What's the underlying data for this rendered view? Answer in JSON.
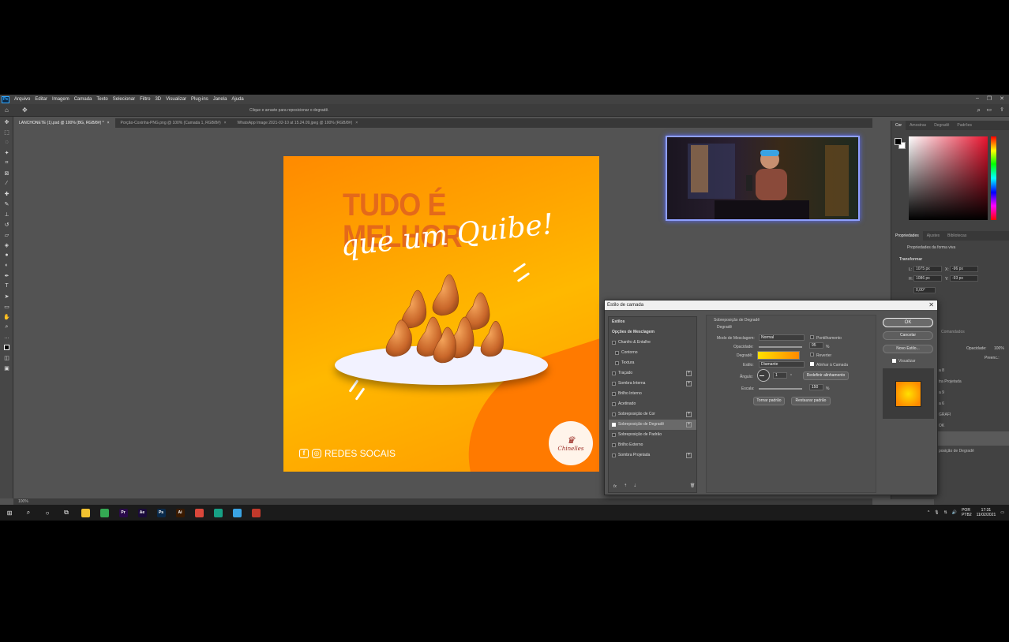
{
  "menu": [
    "Arquivo",
    "Editar",
    "Imagem",
    "Camada",
    "Texto",
    "Selecionar",
    "Filtro",
    "3D",
    "Visualizar",
    "Plug-ins",
    "Janela",
    "Ajuda"
  ],
  "options_hint": "Clique e arraste para reposicionar o degradê.",
  "tabs": [
    {
      "label": "LANCHONETE (1).psd @ 100% (BG, RGB/8#) *",
      "active": true
    },
    {
      "label": "Porção-Coxinha-PNG.png @ 100% (Camada 1, RGB/8#)",
      "active": false
    },
    {
      "label": "WhatsApp Image 2021-02-10 at 15.24.09.jpeg @ 100% (RGB/8#)",
      "active": false
    }
  ],
  "artwork": {
    "headline": "TUDO É MELHOR",
    "script": "que um Quibe!",
    "social": "REDES SOCAIS",
    "logo_text": "Chinelles",
    "colors": {
      "bg_start": "#ff8a00",
      "bg_mid": "#ffb800",
      "headline": "#e4691a"
    }
  },
  "right_panel": {
    "color_tabs": [
      "Cor",
      "Amostras",
      "Degradê",
      "Padrões"
    ],
    "prop_tabs": [
      "Propriedades",
      "Ajustes",
      "Bibliotecas"
    ],
    "shape_props": "Propriedades da forma viva",
    "transform": "Transformar",
    "W": "1075 px",
    "X": "-96 px",
    "H": "1086 px",
    "Y": "-93 px",
    "angle": "0,00°",
    "layers_tab": "Comandados",
    "opacity_label": "Opacidade:",
    "opacity_value": "100%",
    "fill_label": "Preenc.:",
    "layers": [
      "a 8",
      "tra Projetada",
      "a 9",
      "a 6",
      "GRAFI",
      "OK",
      "",
      "posição de Degradê"
    ]
  },
  "status": "100%",
  "dialog": {
    "title": "Estilo de camada",
    "styles": [
      {
        "label": "Estilos",
        "check": false,
        "plus": false,
        "header": true
      },
      {
        "label": "Opções de Mesclagem",
        "check": false,
        "plus": false,
        "header": true
      },
      {
        "label": "Chanfro & Entalhe",
        "check": true,
        "on": false,
        "plus": false
      },
      {
        "label": "Contorno",
        "check": true,
        "on": false,
        "plus": false,
        "indent": true
      },
      {
        "label": "Textura",
        "check": true,
        "on": false,
        "plus": false,
        "indent": true
      },
      {
        "label": "Traçado",
        "check": true,
        "on": false,
        "plus": true
      },
      {
        "label": "Sombra Interna",
        "check": true,
        "on": false,
        "plus": true
      },
      {
        "label": "Brilho Interno",
        "check": true,
        "on": false,
        "plus": false
      },
      {
        "label": "Acetinado",
        "check": true,
        "on": false,
        "plus": false
      },
      {
        "label": "Sobreposição de Cor",
        "check": true,
        "on": false,
        "plus": true
      },
      {
        "label": "Sobreposição de Degradê",
        "check": true,
        "on": true,
        "plus": true,
        "selected": true
      },
      {
        "label": "Sobreposição de Padrão",
        "check": true,
        "on": false,
        "plus": false
      },
      {
        "label": "Brilho Externo",
        "check": true,
        "on": false,
        "plus": false
      },
      {
        "label": "Sombra Projetada",
        "check": true,
        "on": false,
        "plus": true
      }
    ],
    "section_title": "Sobreposição de Degradê",
    "sub_title": "Degradê",
    "blend_label": "Modo de Mesclagem:",
    "blend_value": "Normal",
    "dither": "Pontilhamento",
    "opacity_label": "Opacidade:",
    "opacity_value": "95",
    "pct": "%",
    "gradient_label": "Degradê:",
    "reverse": "Reverter",
    "style_label": "Estilo:",
    "style_value": "Diamante",
    "align": "Alinhar à Camada",
    "angle_label": "Ângulo:",
    "angle_value": "1",
    "angle_unit": "°",
    "reset_align": "Redefinir alinhamento",
    "scale_label": "Escala:",
    "scale_value": "150",
    "make_default": "Tornar padrão",
    "reset_default": "Restaurar padrão",
    "ok": "OK",
    "cancel": "Cancelar",
    "new_style": "Novo Estilo...",
    "preview": "Visualizar",
    "fx": "fx"
  },
  "taskbar": {
    "lang": "POR",
    "layout": "PTB2",
    "time": "17:31",
    "date": "11/02/2021",
    "apps": [
      {
        "name": "file-explorer-icon",
        "label": "",
        "color": "#f2c230"
      },
      {
        "name": "chrome-icon",
        "label": "",
        "color": "#34a853"
      },
      {
        "name": "premiere-icon",
        "label": "Pr",
        "color": "#2a0a4a"
      },
      {
        "name": "after-effects-icon",
        "label": "Ae",
        "color": "#1a0a3a"
      },
      {
        "name": "photoshop-icon",
        "label": "Ps",
        "color": "#0a2a4a"
      },
      {
        "name": "illustrator-icon",
        "label": "Ai",
        "color": "#3a1a00"
      },
      {
        "name": "recorder-icon",
        "label": "",
        "color": "#d9473b"
      },
      {
        "name": "app-green-icon",
        "label": "",
        "color": "#17a085"
      },
      {
        "name": "app-blue-icon",
        "label": "",
        "color": "#3aa3e3"
      },
      {
        "name": "archive-icon",
        "label": "",
        "color": "#c0392b"
      }
    ]
  }
}
